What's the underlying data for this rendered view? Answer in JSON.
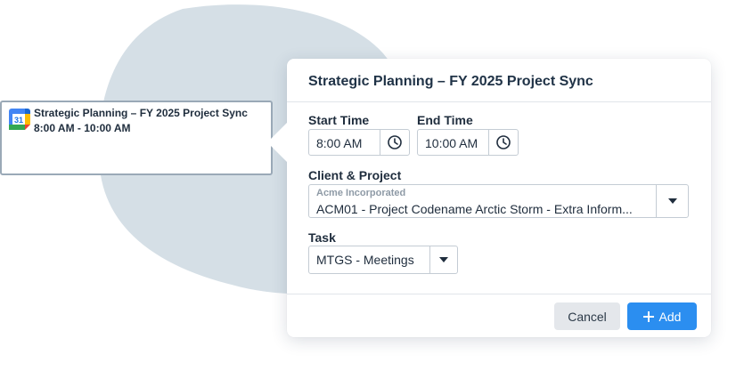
{
  "event": {
    "calendar_day": "31",
    "title": "Strategic Planning – FY 2025 Project Sync",
    "time_range": "8:00 AM - 10:00 AM"
  },
  "popover": {
    "title": "Strategic Planning – FY 2025 Project Sync",
    "start_time_label": "Start Time",
    "start_time_value": "8:00 AM",
    "end_time_label": "End Time",
    "end_time_value": "10:00 AM",
    "client_project_label": "Client & Project",
    "client_name": "Acme Incorporated",
    "project_value": "ACM01 - Project Codename Arctic Storm - Extra Inform...",
    "task_label": "Task",
    "task_value": "MTGS - Meetings",
    "cancel_label": "Cancel",
    "add_label": "Add"
  },
  "colors": {
    "accent": "#2b8ef0",
    "blob": "#d5dfe6",
    "title": "#1f3246"
  },
  "icons": {
    "calendar": "google-calendar-icon",
    "clock": "clock-icon",
    "caret": "chevron-down-icon",
    "add": "plus-icon"
  }
}
